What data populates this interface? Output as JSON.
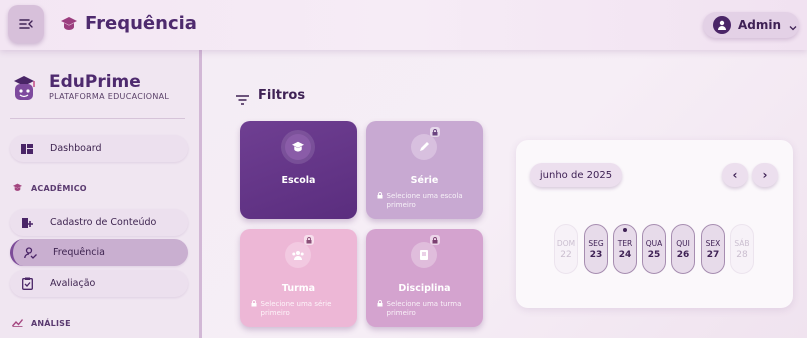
{
  "header": {
    "title": "Frequência",
    "user": "Admin"
  },
  "sidebar": {
    "brand": "EduPrime",
    "brand_sub": "PLATAFORMA EDUCACIONAL",
    "dashboard": "Dashboard",
    "section_academico": "ACADÊMICO",
    "items": [
      {
        "label": "Cadastro de Conteúdo"
      },
      {
        "label": "Frequência"
      },
      {
        "label": "Avaliação"
      }
    ],
    "section_analise": "ANÁLISE"
  },
  "filters": {
    "title": "Filtros",
    "cards": [
      {
        "name": "Escola",
        "hint": ""
      },
      {
        "name": "Série",
        "hint": "Selecione uma escola primeiro"
      },
      {
        "name": "Turma",
        "hint": "Selecione uma série primeiro"
      },
      {
        "name": "Disciplina",
        "hint": "Selecione uma turma primeiro"
      }
    ]
  },
  "calendar": {
    "month": "junho de 2025",
    "prev": "‹",
    "next": "›",
    "days": [
      {
        "name": "DOM",
        "num": "22"
      },
      {
        "name": "SEG",
        "num": "23"
      },
      {
        "name": "TER",
        "num": "24"
      },
      {
        "name": "QUA",
        "num": "25"
      },
      {
        "name": "QUI",
        "num": "26"
      },
      {
        "name": "SEX",
        "num": "27"
      },
      {
        "name": "SÁB",
        "num": "28"
      }
    ]
  },
  "colors": {
    "primary": "#5a2d7e",
    "accent": "#edb7d6",
    "bg": "#f3ecf4"
  }
}
